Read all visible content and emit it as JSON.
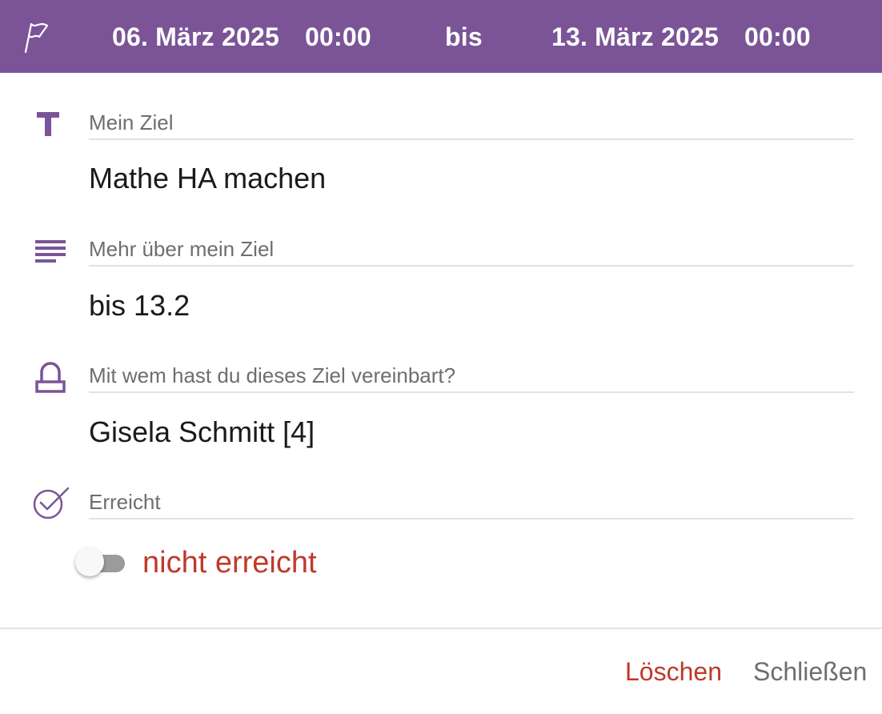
{
  "header": {
    "start_date": "06. März 2025",
    "start_time": "00:00",
    "separator": "bis",
    "end_date": "13. März 2025",
    "end_time": "00:00",
    "icon": "flag-icon",
    "background": "#7a5497"
  },
  "fields": [
    {
      "label": "Mein Ziel",
      "value": "Mathe HA machen",
      "icon": "title-icon"
    },
    {
      "label": "Mehr über mein Ziel",
      "value": "bis 13.2",
      "icon": "text-lines-icon"
    },
    {
      "label": "Mit wem hast du dieses Ziel vereinbart?",
      "value": "Gisela Schmitt [4]",
      "icon": "person-icon"
    },
    {
      "label": "Erreicht",
      "icon": "check-circle-icon"
    }
  ],
  "achieved_toggle": {
    "on": false,
    "text": "nicht erreicht",
    "color": "#c0392b"
  },
  "footer": {
    "delete_label": "Löschen",
    "close_label": "Schließen"
  },
  "colors": {
    "accent": "#7a5497",
    "danger": "#c0392b",
    "muted": "#6e6e6e"
  }
}
